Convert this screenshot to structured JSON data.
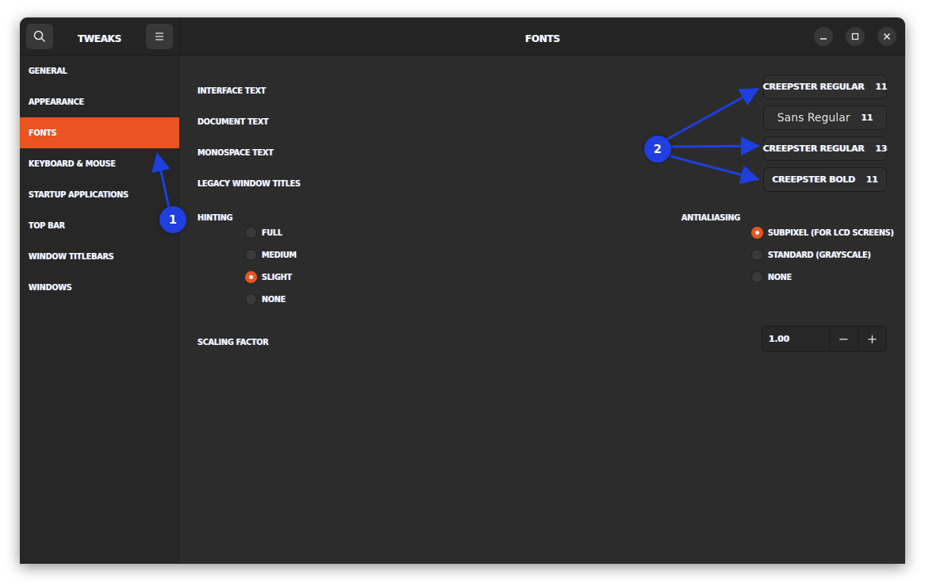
{
  "header": {
    "app_title": "Tweaks",
    "page_title": "Fonts",
    "search_icon": "search-icon",
    "menu_icon": "hamburger-menu-icon",
    "window_controls": [
      "minimize",
      "maximize",
      "close"
    ]
  },
  "sidebar": {
    "items": [
      {
        "label": "General",
        "active": false
      },
      {
        "label": "Appearance",
        "active": false
      },
      {
        "label": "Fonts",
        "active": true
      },
      {
        "label": "Keyboard & Mouse",
        "active": false
      },
      {
        "label": "Startup Applications",
        "active": false
      },
      {
        "label": "Top Bar",
        "active": false
      },
      {
        "label": "Window Titlebars",
        "active": false
      },
      {
        "label": "Windows",
        "active": false
      }
    ]
  },
  "fonts": {
    "rows": [
      {
        "label": "Interface Text",
        "font": "Creepster Regular",
        "size": "11"
      },
      {
        "label": "Document Text",
        "font": "Sans Regular",
        "size": "11"
      },
      {
        "label": "Monospace Text",
        "font": "Creepster Regular",
        "size": "13"
      },
      {
        "label": "Legacy Window Titles",
        "font": "Creepster Bold",
        "size": "11"
      }
    ],
    "hinting": {
      "label": "Hinting",
      "options": [
        "Full",
        "Medium",
        "Slight",
        "None"
      ],
      "selected": "Slight"
    },
    "antialiasing": {
      "label": "Antialiasing",
      "options": [
        "Subpixel (for LCD screens)",
        "Standard (grayscale)",
        "None"
      ],
      "selected": "Subpixel (for LCD screens)"
    },
    "scaling": {
      "label": "Scaling Factor",
      "value": "1.00",
      "decrement": "−",
      "increment": "+"
    }
  },
  "annotations": [
    {
      "number": "1",
      "target": "sidebar-item-fonts"
    },
    {
      "number": "2",
      "target": "font-buttons"
    }
  ],
  "colors": {
    "accent": "#e95420",
    "annotation": "#1f3fe0"
  }
}
